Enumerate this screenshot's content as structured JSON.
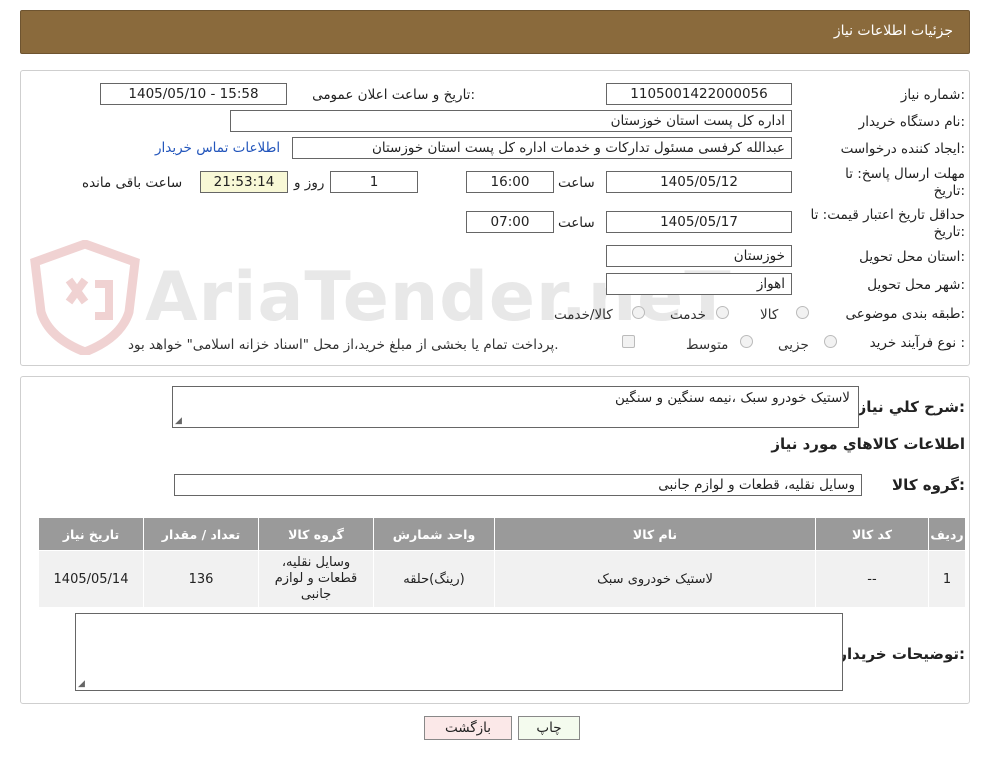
{
  "header": {
    "title": "جزئیات اطلاعات نیاز"
  },
  "watermark": {
    "text": "AriaTender.neT"
  },
  "fields": {
    "need_number_label": "شماره نیاز:",
    "need_number": "1105001422000056",
    "announce_label": "تاریخ و ساعت اعلان عمومی:",
    "announce_value": "1405/05/10 - 15:58",
    "buyer_org_label": "نام دستگاه خریدار:",
    "buyer_org": "اداره کل پست استان خوزستان",
    "requester_label": "ایجاد کننده درخواست:",
    "requester": "عبدالله کرفسی مسئول تدارکات و خدمات اداره کل پست استان خوزستان",
    "contact_link": "اطلاعات تماس خریدار",
    "deadline_label_1": "مهلت ارسال پاسخ: تا",
    "deadline_label_2": "تاریخ:",
    "deadline_date": "1405/05/12",
    "time_label": "ساعت",
    "deadline_time": "16:00",
    "days_value": "1",
    "days_label": "روز و",
    "remaining_time": "21:53:14",
    "remaining_label": "ساعت باقی مانده",
    "validity_label_1": "حداقل تاریخ اعتبار قیمت: تا",
    "validity_label_2": "تاریخ:",
    "validity_date": "1405/05/17",
    "validity_time": "07:00",
    "province_label": "استان محل تحویل:",
    "province": "خوزستان",
    "city_label": "شهر محل تحویل:",
    "city": "اهواز",
    "category_label": "طبقه بندی موضوعی:",
    "category_options": [
      "کالا",
      "خدمت",
      "کالا/خدمت"
    ],
    "process_label": "نوع فرآیند خرید :",
    "process_options": [
      "جزیی",
      "متوسط"
    ],
    "payment_note": "پرداخت تمام یا بخشی از مبلغ خرید،از محل \"اسناد خزانه اسلامی\" خواهد بود."
  },
  "summary": {
    "desc_label": "شرح کلي نياز:",
    "desc_value": "لاستیک خودرو  سبک ،نیمه سنگین و سنگین",
    "goods_info_title": "اطلاعات کالاهاي مورد نياز",
    "group_label": "گروه کالا:",
    "group_value": "وسایل نقلیه، قطعات و لوازم جانبی"
  },
  "table": {
    "headers": [
      "ردیف",
      "کد کالا",
      "نام کالا",
      "واحد شمارش",
      "گروه کالا",
      "تعداد / مقدار",
      "تاریخ نیاز"
    ],
    "rows": [
      {
        "row": "1",
        "code": "--",
        "name": "لاستیک خودروی سبک",
        "unit": "(رینگ)حلقه",
        "group": "وسایل نقلیه، قطعات و لوازم جانبی",
        "qty": "136",
        "date": "1405/05/14"
      }
    ]
  },
  "buyer_notes": {
    "label": "توضیحات خریدار:",
    "value": ""
  },
  "buttons": {
    "print": "چاپ",
    "back": "بازگشت"
  }
}
